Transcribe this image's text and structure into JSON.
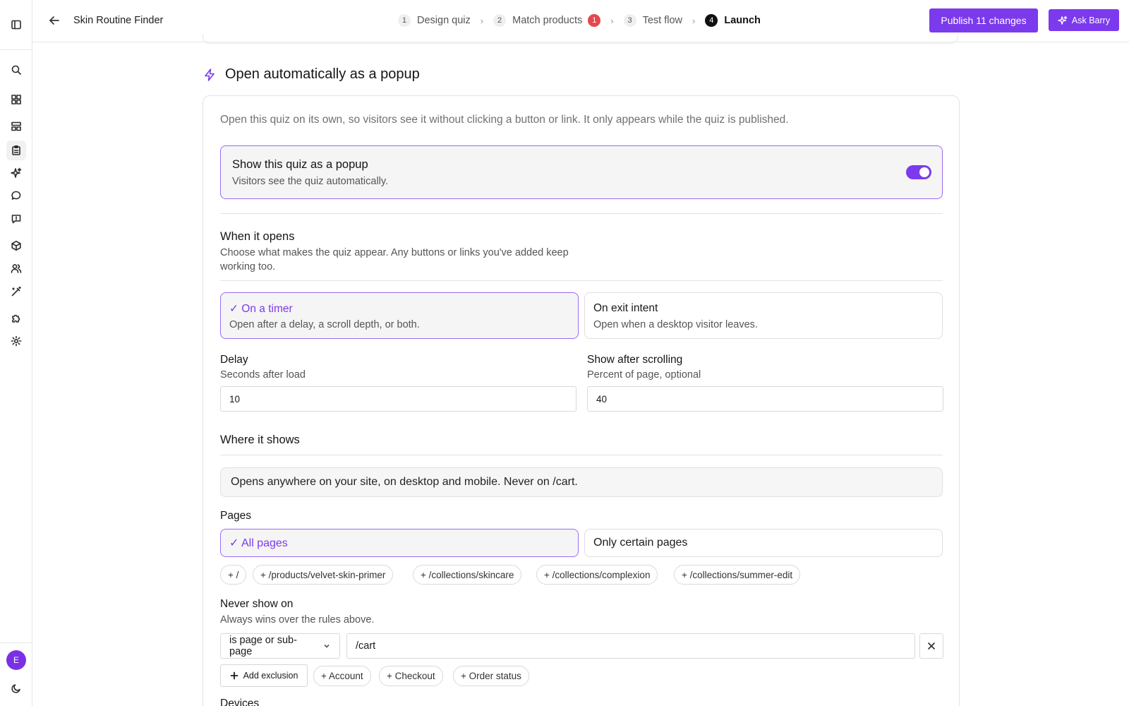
{
  "rail": {
    "items": [
      {
        "name": "sidebar-toggle-icon"
      },
      {
        "name": "search-icon"
      },
      {
        "name": "dashboard-icon"
      },
      {
        "name": "layout-icon"
      },
      {
        "name": "quiz-clipboard-icon"
      },
      {
        "name": "sparkles-icon"
      },
      {
        "name": "chat-icon"
      },
      {
        "name": "message-square-icon"
      },
      {
        "name": "box-icon"
      },
      {
        "name": "users-icon"
      },
      {
        "name": "magic-wand-icon"
      },
      {
        "name": "puzzle-icon"
      },
      {
        "name": "settings-icon"
      },
      {
        "name": "moon-icon"
      }
    ],
    "avatar_initial": "E"
  },
  "header": {
    "title": "Skin Routine Finder",
    "steps": [
      {
        "num": "1",
        "label": "Design quiz"
      },
      {
        "num": "2",
        "label": "Match products",
        "badge": "1"
      },
      {
        "num": "3",
        "label": "Test flow"
      },
      {
        "num": "4",
        "label": "Launch"
      }
    ],
    "current_step": 4,
    "publish_label": "Publish 11 changes",
    "ask_label": "Ask Barry"
  },
  "section": {
    "title": "Open automatically as a popup",
    "intro": "Open this quiz on its own, so visitors see it without clicking a button or link. It only appears while the quiz is published.",
    "popup": {
      "title": "Show this quiz as a popup",
      "subtitle": "Visitors see the quiz automatically.",
      "enabled": true
    },
    "when": {
      "title": "When it opens",
      "subtitle_line1": "Choose what makes the quiz appear. Any buttons or links you've added keep",
      "subtitle_line2": "working too.",
      "options": [
        {
          "title": "✓ On a timer",
          "subtitle": "Open after a delay, a scroll depth, or both.",
          "selected": true
        },
        {
          "title": "On exit intent",
          "subtitle": "Open when a desktop visitor leaves.",
          "selected": false
        }
      ],
      "delay": {
        "label": "Delay",
        "sublabel": "Seconds after load",
        "value": "10"
      },
      "scroll": {
        "label": "Show after scrolling",
        "sublabel": "Percent of page, optional",
        "value": "40"
      }
    },
    "where": {
      "title": "Where it shows",
      "summary": "Opens anywhere on your site, on desktop and mobile. Never on /cart.",
      "pages_label": "Pages",
      "page_options": [
        {
          "label": "✓ All pages",
          "selected": true
        },
        {
          "label": "Only certain pages",
          "selected": false
        }
      ],
      "page_chips": [
        "+ /",
        "+ /products/velvet-skin-primer",
        "+ /collections/skincare",
        "+ /collections/complexion",
        "+ /collections/summer-edit"
      ],
      "never": {
        "title": "Never show on",
        "subtitle": "Always wins over the rules above.",
        "match_type": "is page or sub-page",
        "path": "/cart",
        "add_label": "Add exclusion",
        "quick_chips": [
          "+ Account",
          "+ Checkout",
          "+ Order status"
        ]
      },
      "devices_label": "Devices"
    }
  },
  "colors": {
    "accent": "#7c3aed",
    "accent_border": "#9b6bf2",
    "badge": "#e5484d"
  }
}
